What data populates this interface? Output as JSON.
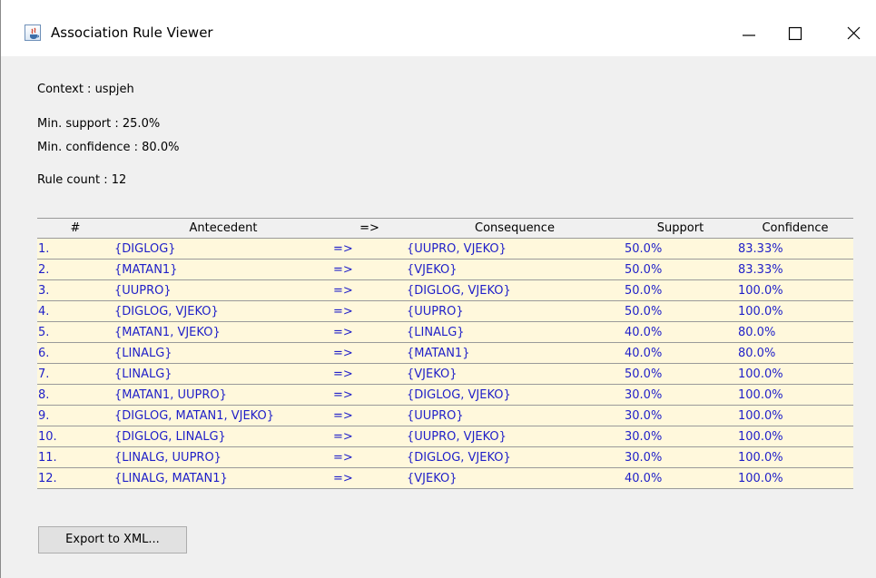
{
  "window": {
    "title": "Association Rule Viewer",
    "controls": [
      "minimize",
      "maximize",
      "close"
    ]
  },
  "info": {
    "context": "Context : uspjeh",
    "min_support": "Min. support : 25.0%",
    "min_confidence": "Min. confidence : 80.0%",
    "rule_count": "Rule count : 12"
  },
  "table": {
    "columns": [
      "#",
      "Antecedent",
      "=>",
      "Consequence",
      "Support",
      "Confidence"
    ],
    "rows": [
      {
        "num": "1.",
        "antecedent": "{DIGLOG}",
        "arrow": "=>",
        "consequence": "{UUPRO, VJEKO}",
        "support": "50.0%",
        "confidence": "83.33%"
      },
      {
        "num": "2.",
        "antecedent": "{MATAN1}",
        "arrow": "=>",
        "consequence": "{VJEKO}",
        "support": "50.0%",
        "confidence": "83.33%"
      },
      {
        "num": "3.",
        "antecedent": "{UUPRO}",
        "arrow": "=>",
        "consequence": "{DIGLOG, VJEKO}",
        "support": "50.0%",
        "confidence": "100.0%"
      },
      {
        "num": "4.",
        "antecedent": "{DIGLOG, VJEKO}",
        "arrow": "=>",
        "consequence": "{UUPRO}",
        "support": "50.0%",
        "confidence": "100.0%"
      },
      {
        "num": "5.",
        "antecedent": "{MATAN1, VJEKO}",
        "arrow": "=>",
        "consequence": "{LINALG}",
        "support": "40.0%",
        "confidence": "80.0%"
      },
      {
        "num": "6.",
        "antecedent": "{LINALG}",
        "arrow": "=>",
        "consequence": "{MATAN1}",
        "support": "40.0%",
        "confidence": "80.0%"
      },
      {
        "num": "7.",
        "antecedent": "{LINALG}",
        "arrow": "=>",
        "consequence": "{VJEKO}",
        "support": "50.0%",
        "confidence": "100.0%"
      },
      {
        "num": "8.",
        "antecedent": "{MATAN1, UUPRO}",
        "arrow": "=>",
        "consequence": "{DIGLOG, VJEKO}",
        "support": "30.0%",
        "confidence": "100.0%"
      },
      {
        "num": "9.",
        "antecedent": "{DIGLOG, MATAN1, VJEKO}",
        "arrow": "=>",
        "consequence": "{UUPRO}",
        "support": "30.0%",
        "confidence": "100.0%"
      },
      {
        "num": "10.",
        "antecedent": "{DIGLOG, LINALG}",
        "arrow": "=>",
        "consequence": "{UUPRO, VJEKO}",
        "support": "30.0%",
        "confidence": "100.0%"
      },
      {
        "num": "11.",
        "antecedent": "{LINALG, UUPRO}",
        "arrow": "=>",
        "consequence": "{DIGLOG, VJEKO}",
        "support": "30.0%",
        "confidence": "100.0%"
      },
      {
        "num": "12.",
        "antecedent": "{LINALG, MATAN1}",
        "arrow": "=>",
        "consequence": "{VJEKO}",
        "support": "40.0%",
        "confidence": "100.0%"
      }
    ]
  },
  "buttons": {
    "export_label": "Export to XML..."
  },
  "colors": {
    "window_background": "#f0f0f0",
    "row_background": "#fff8dc",
    "row_text": "#1f1fc8",
    "grid_line": "#9a9a9a"
  },
  "icons": {
    "app": "java-app-icon",
    "minimize": "minimize-icon",
    "maximize": "maximize-icon",
    "close": "close-icon"
  }
}
